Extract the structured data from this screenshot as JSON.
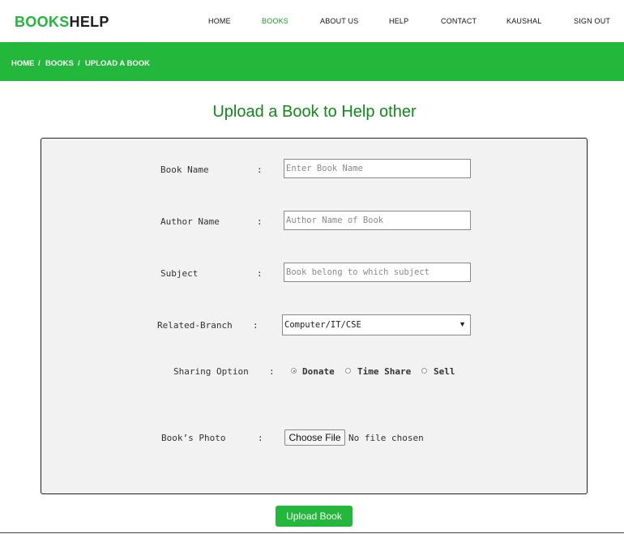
{
  "logo": {
    "part1": "BOOKS",
    "part2": "HELP"
  },
  "nav": {
    "items": [
      {
        "label": "HOME"
      },
      {
        "label": "BOOKS",
        "active": true
      },
      {
        "label": "ABOUT US"
      },
      {
        "label": "HELP"
      },
      {
        "label": "CONTACT"
      },
      {
        "label": "KAUSHAL"
      },
      {
        "label": "SIGN OUT"
      }
    ]
  },
  "breadcrumb": {
    "home": "HOME",
    "sep": "/",
    "books": "BOOKS",
    "current": "UPLOAD A BOOK"
  },
  "page": {
    "title": "Upload a Book to Help other"
  },
  "form": {
    "colon": ":",
    "book_name": {
      "label": "Book Name",
      "placeholder": "Enter Book Name",
      "value": ""
    },
    "author_name": {
      "label": "Author Name",
      "placeholder": "Author Name of Book",
      "value": ""
    },
    "subject": {
      "label": "Subject",
      "placeholder": "Book belong to which subject",
      "value": ""
    },
    "branch": {
      "label": "Related-Branch",
      "selected": "Computer/IT/CSE"
    },
    "sharing": {
      "label": "Sharing Option",
      "options": [
        "Donate",
        "Time Share",
        "Sell"
      ],
      "selected": "Donate"
    },
    "photo": {
      "label": "Book’s Photo",
      "button": "Choose File",
      "status": "No file chosen"
    },
    "submit": "Upload Book"
  },
  "colors": {
    "brand_green": "#23b83b",
    "title_green": "#0f8a17",
    "panel_bg": "#f2f2f2"
  },
  "icons": {
    "select_arrow": "dropdown-arrow-icon"
  }
}
